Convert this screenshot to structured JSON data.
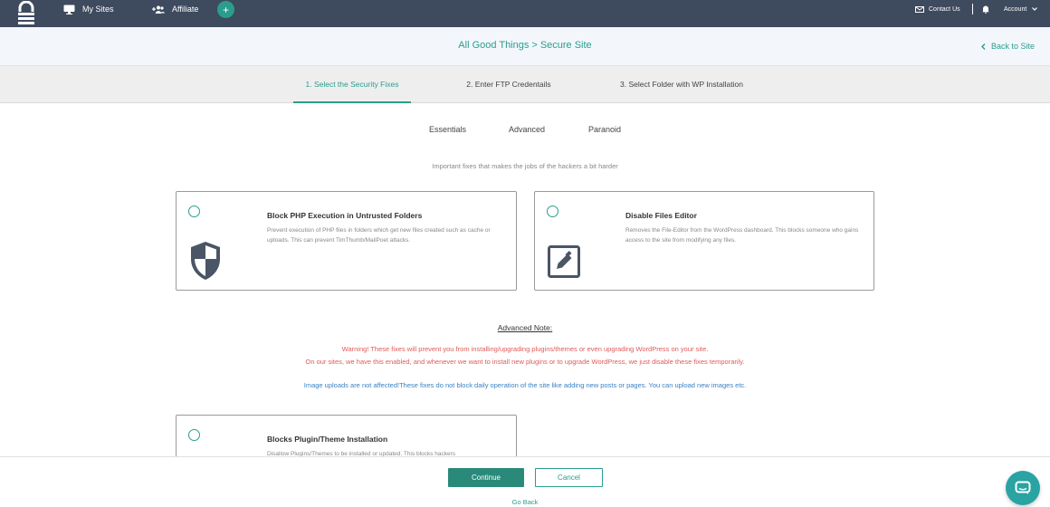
{
  "nav": {
    "my_sites": "My Sites",
    "affiliate": "Affiliate",
    "add_button": "+",
    "contact_us": "Contact Us",
    "account": "Account"
  },
  "header": {
    "site_name": "All Good Things",
    "separator": ">",
    "page_title": "Secure Site",
    "back_link": "Back to Site"
  },
  "steps": [
    {
      "label": "1. Select the Security Fixes",
      "active": true
    },
    {
      "label": "2. Enter FTP Credentails",
      "active": false
    },
    {
      "label": "3. Select Folder with WP Installation",
      "active": false
    }
  ],
  "levels": [
    "Essentials",
    "Advanced",
    "Paranoid"
  ],
  "subtitle": "Important fixes that makes the jobs of the hackers a bit harder",
  "cards": [
    {
      "title": "Block PHP Execution in Untrusted Folders",
      "description": "Prevent execution of PHP files in folders which get new files created such as cache or uploads. This can prevent TimThumb/MailPoet attacks.",
      "icon": "shield-icon"
    },
    {
      "title": "Disable Files Editor",
      "description": "Removes the File-Editor from the WordPress dashboard. This blocks someone who gains access to the site from modifying any files.",
      "icon": "edit-icon"
    },
    {
      "title": "Blocks Plugin/Theme Installation",
      "description": "Disallow Plugins/Themes to be installed or updated. This blocks hackers",
      "icon": ""
    }
  ],
  "advanced_note": {
    "heading": "Advanced Note:",
    "warning_1": "Warning! These fixes will prevent you from installing/upgrading plugins/themes or even upgrading WordPress on your site.",
    "warning_2": "On our sites, we have this enabled, and whenever we want to install new plugins or to upgrade WordPress, we just disable these fixes temporarily.",
    "info": "Image uploads are not affected!These fixes do not block daily operation of the site like adding new posts or pages. You can upload new images etc."
  },
  "footer": {
    "continue": "Continue",
    "cancel": "Cancel",
    "go_back": "Go Back"
  },
  "colors": {
    "nav_bg": "#3e4a5e",
    "accent": "#2a9d8f",
    "warning": "#e05a5a",
    "info": "#3a82c4"
  }
}
